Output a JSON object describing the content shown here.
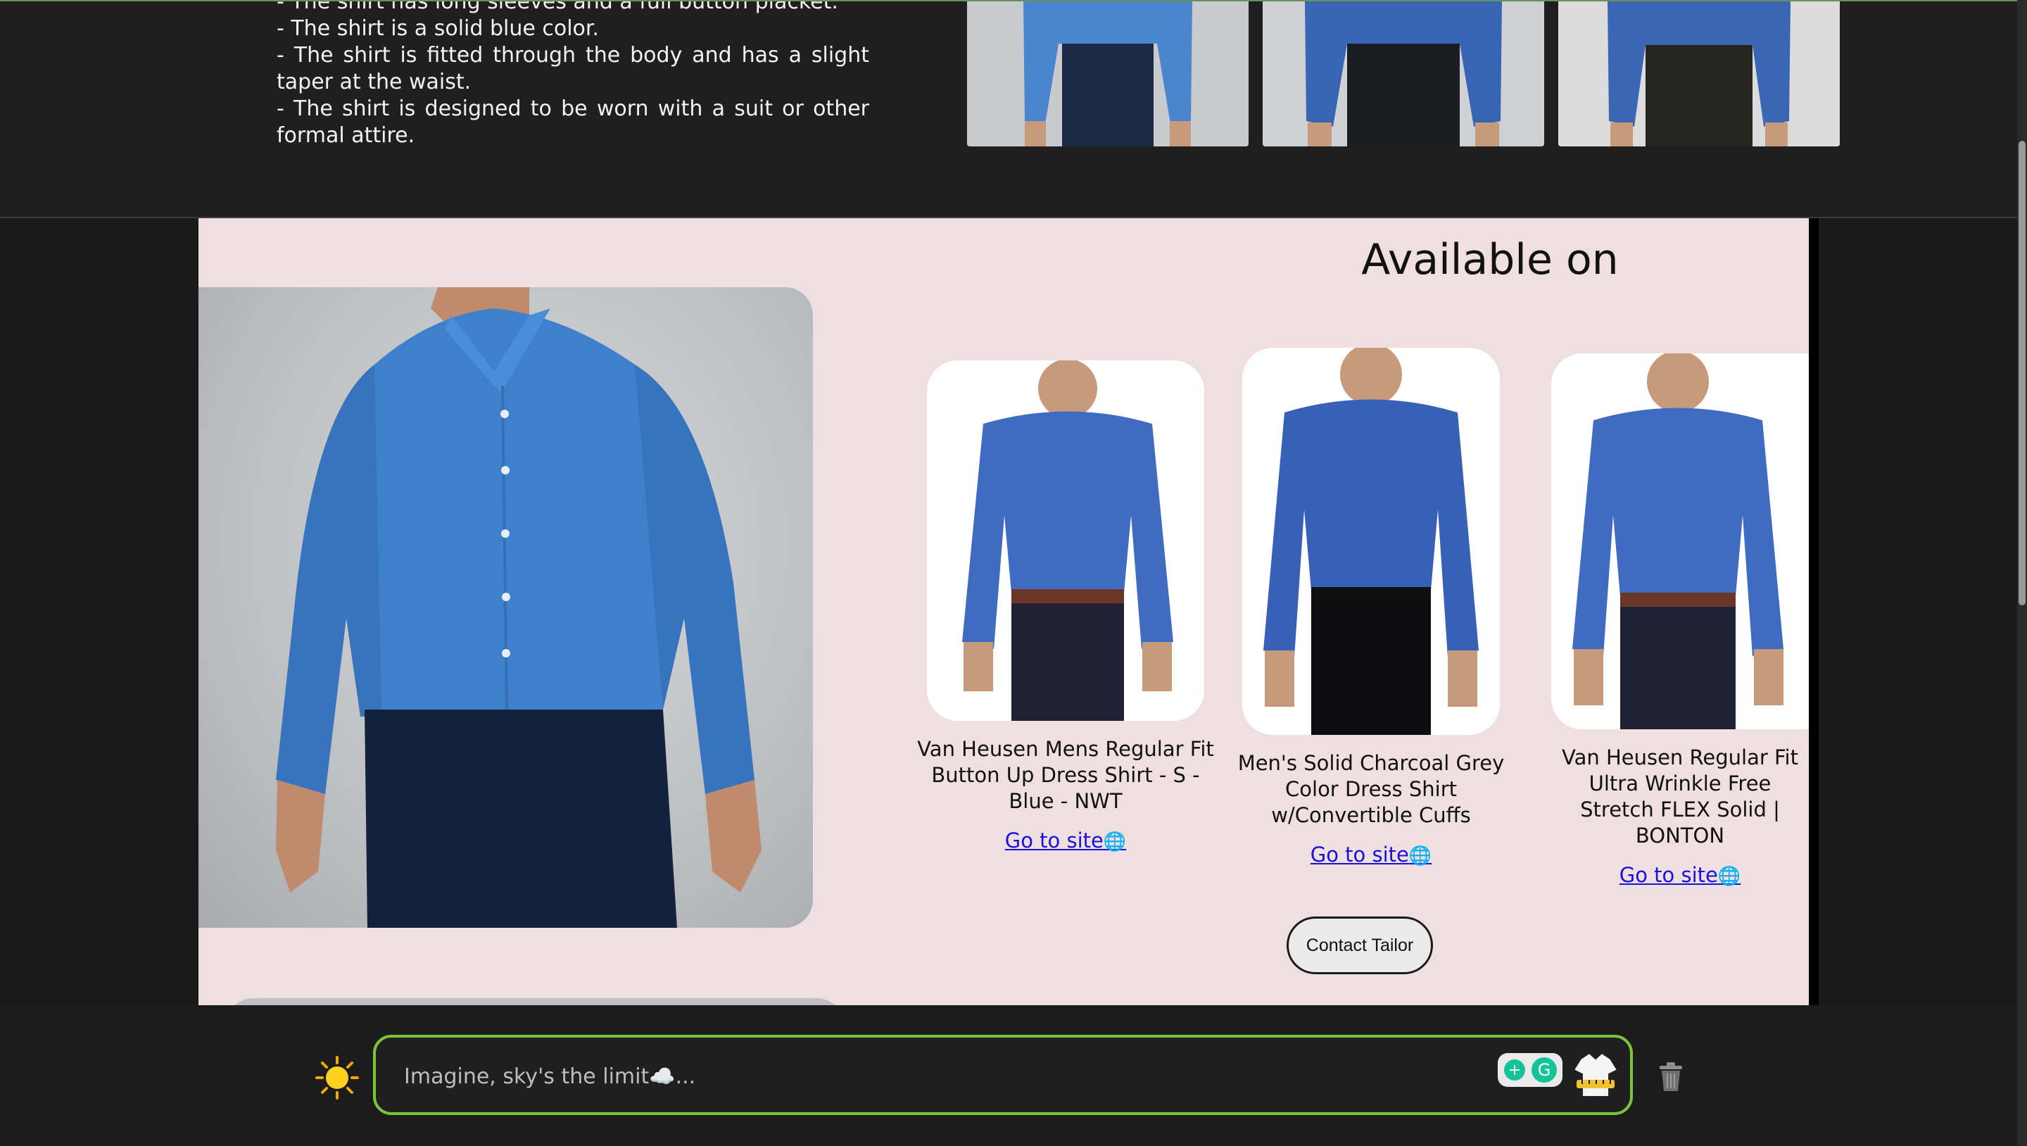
{
  "description": {
    "lines": [
      "- The shirt has long sleeves and a full button placket.",
      "- The shirt is a solid blue color.",
      "- The shirt is fitted through the body and has a slight taper at the waist.",
      "- The shirt is designed to be worn with a suit or other formal attire."
    ]
  },
  "available": {
    "title": "Available on",
    "cards": [
      {
        "title": "Van Heusen Mens Regular Fit Button Up Dress Shirt - S - Blue - NWT",
        "link": "Go to site"
      },
      {
        "title": "Men's Solid Charcoal Grey Color Dress Shirt w/Convertible Cuffs",
        "link": "Go to site"
      },
      {
        "title": "Van Heusen Regular Fit Ultra Wrinkle Free Stretch FLEX Solid | BONTON",
        "link": "Go to site"
      }
    ],
    "contact_label": "Contact Tailor"
  },
  "chat": {
    "placeholder": "Imagine, sky's the limit☁️..."
  },
  "colors": {
    "panel_bg": "#efdfe0",
    "shirt_blue": "#3f80cc",
    "accent_green": "#7ac43a",
    "link_blue": "#1a12d6"
  },
  "icons": [
    "sun-icon",
    "globe-icon",
    "grammarly-icon",
    "tailor-shirt-icon",
    "trash-icon"
  ]
}
